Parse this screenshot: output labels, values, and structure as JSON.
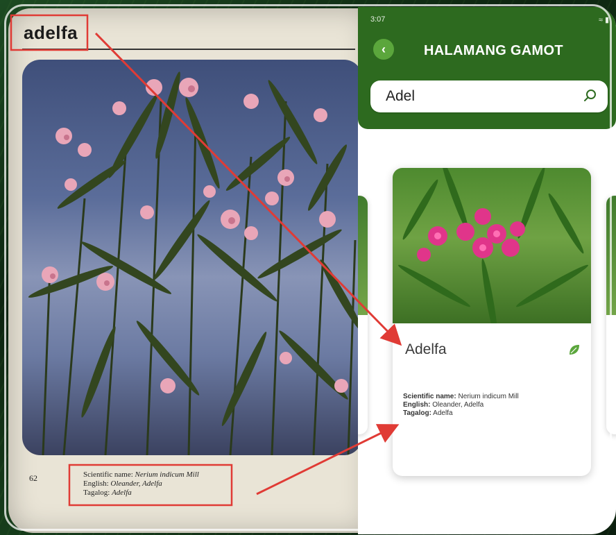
{
  "book": {
    "title": "adelfa",
    "page_number": "62",
    "caption": {
      "scientific_label": "Scientific name:",
      "scientific_value": "Nerium indicum Mill",
      "english_label": "English:",
      "english_value": "Oleander, Adelfa",
      "tagalog_label": "Tagalog:",
      "tagalog_value": "Adelfa"
    }
  },
  "app": {
    "status_time": "3:07",
    "title": "HALAMANG GAMOT",
    "search": {
      "value": "Adel"
    },
    "card": {
      "name": "Adelfa",
      "scientific_label": "Scientific name:",
      "scientific_value": "Nerium indicum Mill",
      "english_label": "English:",
      "english_value": "Oleander, Adelfa",
      "tagalog_label": "Tagalog:",
      "tagalog_value": "Adelfa"
    }
  },
  "colors": {
    "header_green": "#2d6a1f",
    "accent_green": "#5ba63c",
    "annotation_red": "#e03b35"
  },
  "icons": [
    "back-icon",
    "search-icon",
    "leaf-icon",
    "wifi-icon",
    "signal-icon",
    "battery-icon"
  ]
}
